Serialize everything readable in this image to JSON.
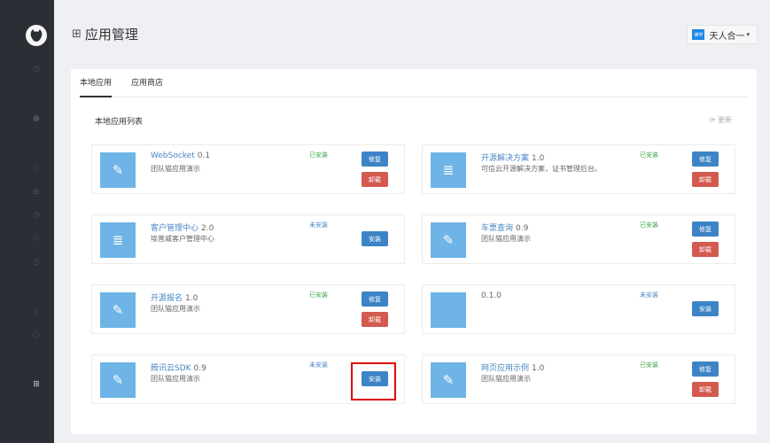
{
  "header": {
    "title": "应用管理",
    "user_avatar": "佛学",
    "user_name": "天人合一"
  },
  "tabs": [
    "本地应用",
    "应用商店"
  ],
  "list_title": "本地应用列表",
  "refresh_label": "更新",
  "apps": [
    {
      "name": "WebSocket",
      "version": "0.1",
      "desc": "团队猫应用演示",
      "status": "已安装",
      "icon": "puzzle-icon",
      "buttons": [
        "修复",
        "卸载"
      ]
    },
    {
      "name": "开源解决方案",
      "version": "1.0",
      "desc": "可信云开源解决方案，证书管理后台。",
      "status": "已安装",
      "icon": "database-icon",
      "buttons": [
        "修复",
        "卸载"
      ]
    },
    {
      "name": "客户管理中心",
      "version": "2.0",
      "desc": "埃普威客户管理中心",
      "status": "未安装",
      "icon": "database-icon",
      "buttons": [
        "安装"
      ]
    },
    {
      "name": "车票查询",
      "version": "0.9",
      "desc": "团队猫应用演示",
      "status": "已安装",
      "icon": "puzzle-icon",
      "buttons": [
        "修复",
        "卸载"
      ]
    },
    {
      "name": "开源报名",
      "version": "1.0",
      "desc": "团队猫应用演示",
      "status": "已安装",
      "icon": "puzzle-icon",
      "buttons": [
        "修复",
        "卸载"
      ]
    },
    {
      "name": "",
      "version": "0.1.0",
      "desc": "",
      "status": "未安装",
      "icon": "",
      "buttons": [
        "安装"
      ]
    },
    {
      "name": "腾讯云SDK",
      "version": "0.9",
      "desc": "团队猫应用演示",
      "status": "未安装",
      "icon": "puzzle-icon",
      "buttons": [
        "安装"
      ]
    },
    {
      "name": "网页应用示例",
      "version": "1.0",
      "desc": "团队猫应用演示",
      "status": "已安装",
      "icon": "puzzle-icon",
      "buttons": [
        "修复",
        "卸载"
      ]
    }
  ],
  "colors": {
    "sidebar": "#2b2e35",
    "accent": "#3d84c6",
    "danger": "#d35a4f",
    "installed": "#3aa146",
    "highlight": "#e00000"
  }
}
